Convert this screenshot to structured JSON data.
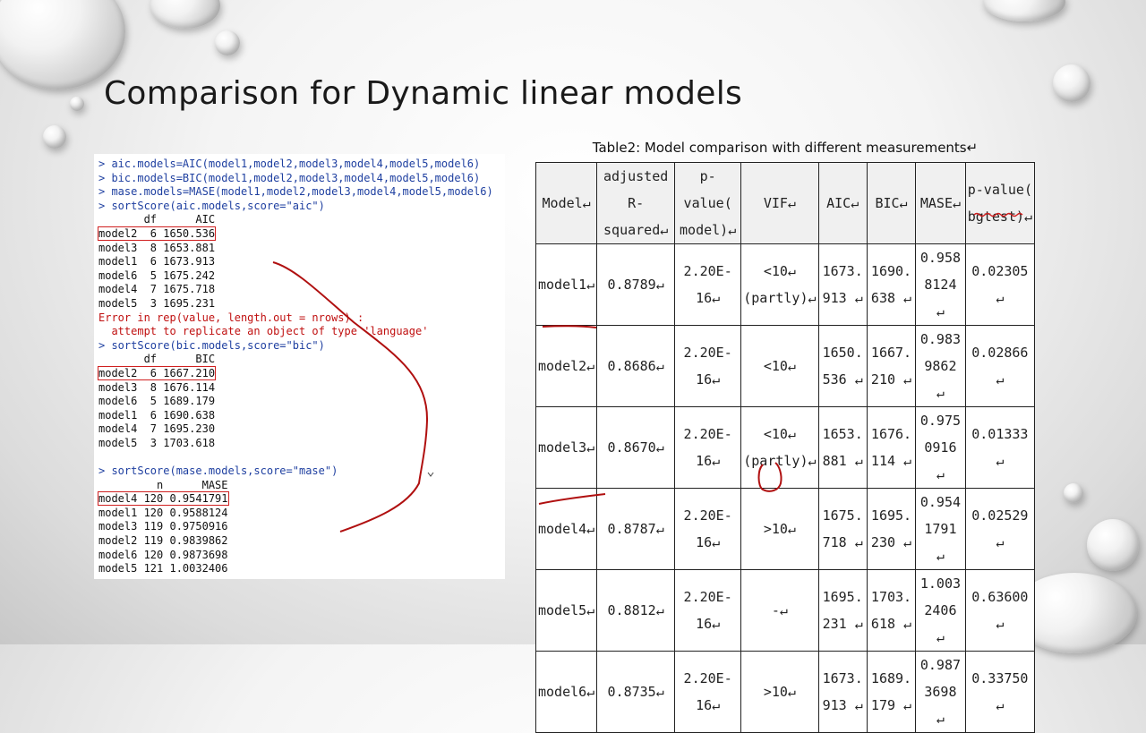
{
  "slide": {
    "title": "Comparison for Dynamic linear models"
  },
  "console": {
    "lines": [
      {
        "kind": "cmd",
        "text": "> aic.models=AIC(model1,model2,model3,model4,model5,model6)"
      },
      {
        "kind": "cmd",
        "text": "> bic.models=BIC(model1,model2,model3,model4,model5,model6)"
      },
      {
        "kind": "cmd",
        "text": "> mase.models=MASE(model1,model2,model3,model4,model5,model6)"
      },
      {
        "kind": "cmd",
        "text": "> sortScore(aic.models,score=\"aic\")"
      },
      {
        "kind": "out",
        "text": "       df      AIC"
      },
      {
        "kind": "out",
        "text": "model2  6 1650.536",
        "highlight": true
      },
      {
        "kind": "out",
        "text": "model3  8 1653.881"
      },
      {
        "kind": "out",
        "text": "model1  6 1673.913"
      },
      {
        "kind": "out",
        "text": "model6  5 1675.242"
      },
      {
        "kind": "out",
        "text": "model4  7 1675.718"
      },
      {
        "kind": "out",
        "text": "model5  3 1695.231"
      },
      {
        "kind": "err",
        "text": "Error in rep(value, length.out = nrows) :"
      },
      {
        "kind": "err",
        "text": "  attempt to replicate an object of type 'language'"
      },
      {
        "kind": "cmd",
        "text": "> sortScore(bic.models,score=\"bic\")"
      },
      {
        "kind": "out",
        "text": "       df      BIC"
      },
      {
        "kind": "out",
        "text": "model2  6 1667.210",
        "highlight": true
      },
      {
        "kind": "out",
        "text": "model3  8 1676.114"
      },
      {
        "kind": "out",
        "text": "model6  5 1689.179"
      },
      {
        "kind": "out",
        "text": "model1  6 1690.638"
      },
      {
        "kind": "out",
        "text": "model4  7 1695.230"
      },
      {
        "kind": "out",
        "text": "model5  3 1703.618"
      },
      {
        "kind": "gap",
        "text": ""
      },
      {
        "kind": "cmd",
        "text": "> sortScore(mase.models,score=\"mase\")"
      },
      {
        "kind": "out",
        "text": "         n      MASE"
      },
      {
        "kind": "out",
        "text": "model4 120 0.9541791",
        "highlight": true
      },
      {
        "kind": "out",
        "text": "model1 120 0.9588124"
      },
      {
        "kind": "out",
        "text": "model3 119 0.9750916"
      },
      {
        "kind": "out",
        "text": "model2 119 0.9839862"
      },
      {
        "kind": "out",
        "text": "model6 120 0.9873698"
      },
      {
        "kind": "out",
        "text": "model5 121 1.0032406"
      }
    ]
  },
  "table": {
    "caption": "Table2: Model comparison with different measurements↵",
    "headers": [
      [
        "Model↵"
      ],
      [
        "adjusted",
        "R-squared↵"
      ],
      [
        "p-value(",
        "model)↵"
      ],
      [
        "VIF↵"
      ],
      [
        "AIC↵"
      ],
      [
        "BIC↵"
      ],
      [
        "MASE↵"
      ],
      [
        "p-value(",
        "bgtest)↵"
      ]
    ],
    "rows": [
      [
        [
          "model1↵"
        ],
        [
          "0.8789↵"
        ],
        [
          "2.20E-16↵"
        ],
        [
          "<10↵",
          "(partly)↵"
        ],
        [
          "1673.",
          "913 ↵"
        ],
        [
          "1690.",
          "638 ↵"
        ],
        [
          "0.958",
          "8124 ↵"
        ],
        [
          "0.02305 ↵"
        ]
      ],
      [
        [
          "model2↵"
        ],
        [
          "0.8686↵"
        ],
        [
          "2.20E-16↵"
        ],
        [
          "<10↵"
        ],
        [
          "1650.",
          "536 ↵"
        ],
        [
          "1667.",
          "210 ↵"
        ],
        [
          "0.983",
          "9862 ↵"
        ],
        [
          "0.02866 ↵"
        ]
      ],
      [
        [
          "model3↵"
        ],
        [
          "0.8670↵"
        ],
        [
          "2.20E-16↵"
        ],
        [
          "<10↵",
          "(partly)↵"
        ],
        [
          "1653.",
          "881 ↵"
        ],
        [
          "1676.",
          "114 ↵"
        ],
        [
          "0.975",
          "0916 ↵"
        ],
        [
          "0.01333 ↵"
        ]
      ],
      [
        [
          "model4↵"
        ],
        [
          "0.8787↵"
        ],
        [
          "2.20E-16↵"
        ],
        [
          ">10↵"
        ],
        [
          "1675.",
          "718 ↵"
        ],
        [
          "1695.",
          "230 ↵"
        ],
        [
          "0.954",
          "1791 ↵"
        ],
        [
          "0.02529 ↵"
        ]
      ],
      [
        [
          "model5↵"
        ],
        [
          "0.8812↵"
        ],
        [
          "2.20E-16↵"
        ],
        [
          "-↵"
        ],
        [
          "1695.",
          "231 ↵"
        ],
        [
          "1703.",
          "618 ↵"
        ],
        [
          "1.003",
          "2406 ↵"
        ],
        [
          "0.63600 ↵"
        ]
      ],
      [
        [
          "model6↵"
        ],
        [
          "0.8735↵"
        ],
        [
          "2.20E-16↵"
        ],
        [
          ">10↵"
        ],
        [
          "1673.",
          "913 ↵"
        ],
        [
          "1689.",
          "179 ↵"
        ],
        [
          "0.987",
          "3698 ↵"
        ],
        [
          "0.33750 ↵"
        ]
      ]
    ]
  },
  "colors": {
    "command": "#1e3fa0",
    "error": "#c01010",
    "highlight_box": "#d02020",
    "annotation_ink": "#b01010"
  }
}
